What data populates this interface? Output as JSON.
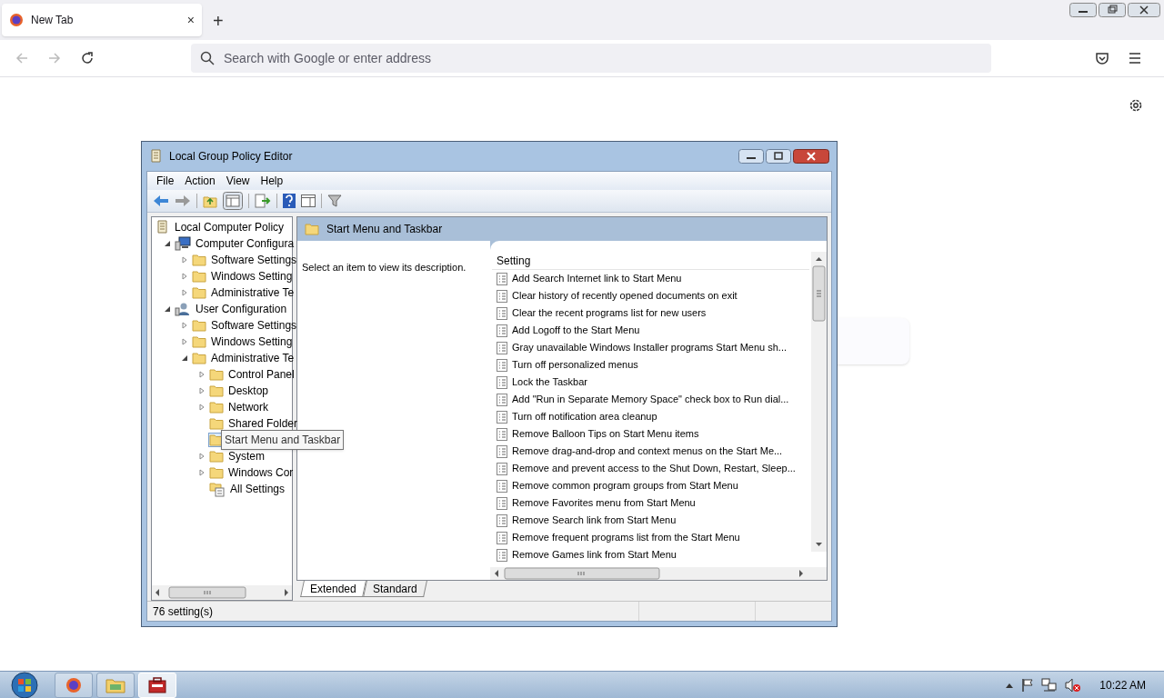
{
  "browser": {
    "tabs": [
      {
        "label": "New Tab",
        "selected": true,
        "close": "×"
      }
    ],
    "new_tab": "+",
    "address_bar": {
      "placeholder": "Search with Google or enter address"
    }
  },
  "window": {
    "title": "Local Group Policy Editor",
    "menu": [
      "File",
      "Action",
      "View",
      "Help"
    ],
    "tree": [
      {
        "label": "Local Computer Policy",
        "kind": "policy",
        "selected": false,
        "children": [
          {
            "label": "Computer Configura",
            "kind": "computer",
            "expanded": true,
            "selected": false,
            "children": [
              {
                "label": "Software Settings",
                "kind": "folder",
                "expanded": false,
                "selected": false
              },
              {
                "label": "Windows Setting",
                "kind": "folder",
                "expanded": false,
                "selected": false
              },
              {
                "label": "Administrative Te",
                "kind": "folder",
                "expanded": false,
                "selected": false
              }
            ]
          },
          {
            "label": "User Configuration",
            "kind": "user",
            "expanded": true,
            "selected": false,
            "children": [
              {
                "label": "Software Settings",
                "kind": "folder",
                "expanded": false,
                "selected": false
              },
              {
                "label": "Windows Setting",
                "kind": "folder",
                "expanded": false,
                "selected": false
              },
              {
                "label": "Administrative Te",
                "kind": "folder",
                "expanded": true,
                "selected": false,
                "children": [
                  {
                    "label": "Control Panel",
                    "kind": "folder",
                    "expanded": false,
                    "selected": false
                  },
                  {
                    "label": "Desktop",
                    "kind": "folder",
                    "expanded": false,
                    "selected": false
                  },
                  {
                    "label": "Network",
                    "kind": "folder",
                    "expanded": false,
                    "selected": false
                  },
                  {
                    "label": "Shared Folder",
                    "kind": "folder",
                    "selected": false
                  },
                  {
                    "tooltip": "Start Menu and Taskbar",
                    "kind": "folder",
                    "selected": true
                  },
                  {
                    "label": "System",
                    "kind": "folder",
                    "expanded": false,
                    "selected": false
                  },
                  {
                    "label": "Windows Cor",
                    "kind": "folder",
                    "expanded": false,
                    "selected": false
                  },
                  {
                    "label": "All Settings",
                    "kind": "settings",
                    "selected": false
                  }
                ]
              }
            ]
          }
        ]
      }
    ],
    "pane_title": "Start Menu and Taskbar",
    "description": "Select an item to view its description.",
    "settings_column": "Setting",
    "settings": [
      "Add Search Internet link to Start Menu",
      "Clear history of recently opened documents on exit",
      "Clear the recent programs list for new users",
      "Add Logoff to the Start Menu",
      "Gray unavailable Windows Installer programs Start Menu sh...",
      "Turn off personalized menus",
      "Lock the Taskbar",
      "Add \"Run in Separate Memory Space\" check box to Run dial...",
      "Turn off notification area cleanup",
      "Remove Balloon Tips on Start Menu items",
      "Remove drag-and-drop and context menus on the Start Me...",
      "Remove and prevent access to the Shut Down, Restart, Sleep...",
      "Remove common program groups from Start Menu",
      "Remove Favorites menu from Start Menu",
      "Remove Search link from Start Menu",
      "Remove frequent programs list from the Start Menu",
      "Remove Games link from Start Menu"
    ],
    "view_tabs": [
      {
        "label": "Extended",
        "selected": true
      },
      {
        "label": "Standard",
        "selected": false
      }
    ],
    "status_bar": "76 setting(s)"
  },
  "taskbar": {
    "apps": [
      {
        "kind": "browser",
        "active": false
      },
      {
        "kind": "explorer",
        "active": false
      },
      {
        "kind": "policy",
        "active": true
      }
    ],
    "clock": "10:22 AM"
  }
}
